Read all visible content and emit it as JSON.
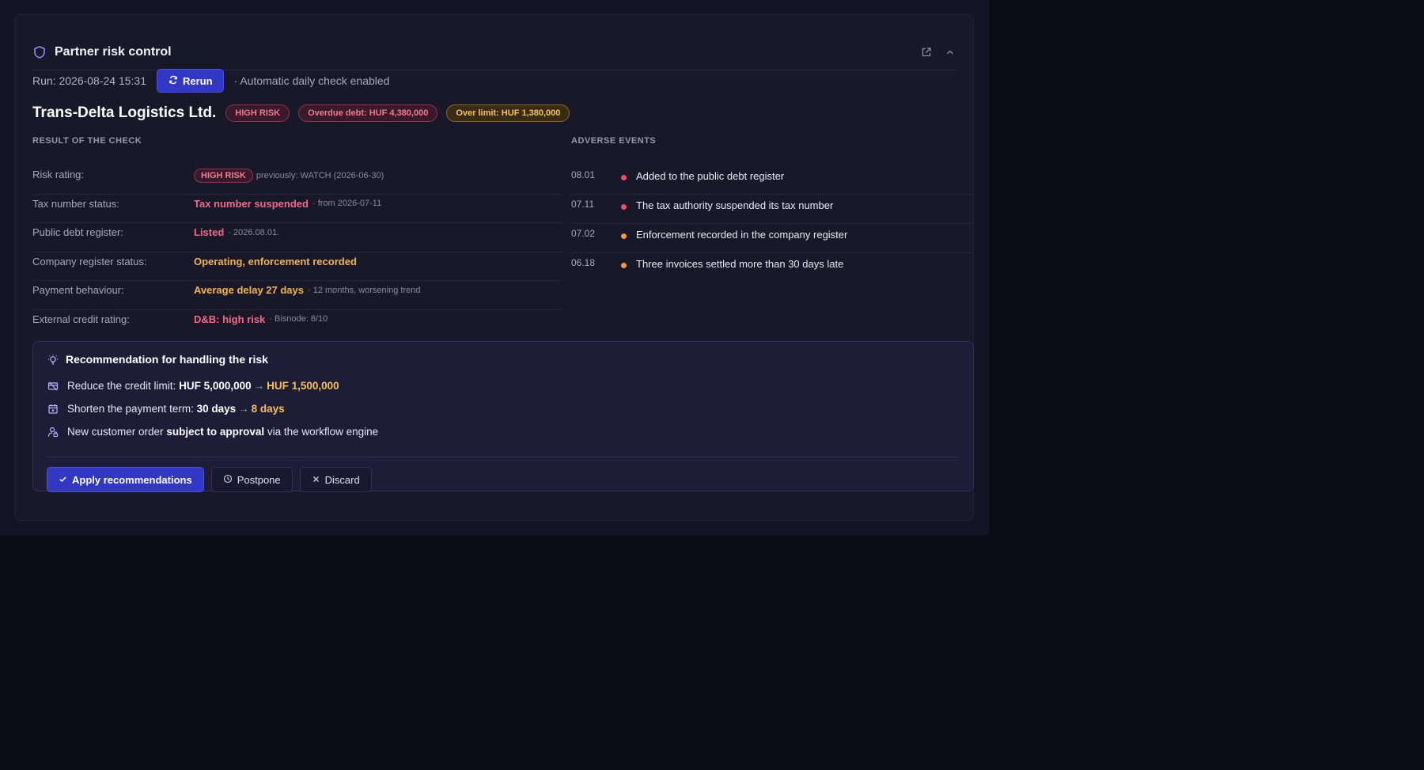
{
  "header": {
    "title": "Partner risk control",
    "icons": [
      "shield-icon",
      "external-link-icon",
      "chevron-up-icon"
    ]
  },
  "run": {
    "label": "Run: 2026-08-24 15:31",
    "rerun_label": "Rerun",
    "auto": "· Automatic daily check enabled"
  },
  "partner": {
    "name": "Trans-Delta Logistics Ltd.",
    "badges": {
      "risk": "HIGH RISK",
      "overdue": "Overdue debt: HUF 4,380,000",
      "overlimit": "Over limit: HUF 1,380,000"
    }
  },
  "checks": {
    "title": "RESULT OF THE CHECK",
    "rows": [
      {
        "label": "Risk rating:",
        "value": "HIGH RISK",
        "note": "previously: WATCH (2026-06-30)"
      },
      {
        "label": "Tax number status:",
        "value": "Tax number suspended",
        "note": "· from 2026-07-11"
      },
      {
        "label": "Public debt register:",
        "value": "Listed",
        "note": "· 2026.08.01."
      },
      {
        "label": "Company register status:",
        "value": "Operating, enforcement recorded",
        "note": ""
      },
      {
        "label": "Payment behaviour:",
        "value": "Average delay 27 days",
        "note": "· 12 months, worsening trend"
      },
      {
        "label": "External credit rating:",
        "value": "D&B: high risk",
        "note": "· Bisnode: 8/10"
      }
    ]
  },
  "events": {
    "title": "ADVERSE EVENTS",
    "items": [
      {
        "date": "08.01",
        "text": "Added to the public debt register",
        "severity_color": "#e84d6e"
      },
      {
        "date": "07.11",
        "text": "The tax authority suspended its tax number",
        "severity_color": "#e84d6e"
      },
      {
        "date": "07.02",
        "text": "Enforcement recorded in the company register",
        "severity_color": "#f39a3a"
      },
      {
        "date": "06.18",
        "text": "Three invoices settled more than 30 days late",
        "severity_color": "#f39a3a"
      }
    ]
  },
  "recommendation": {
    "title": "Recommendation for handling the risk",
    "limit": {
      "prefix": "Reduce the credit limit:",
      "from": "HUF 5,000,000",
      "arrow": "→",
      "to": "HUF 1,500,000"
    },
    "term": {
      "prefix": "Shorten the payment term:",
      "from": "30 days",
      "arrow": "→",
      "to": "8 days"
    },
    "order": {
      "prefix": "New customer order",
      "bold": "subject to approval",
      "suffix": "via the workflow engine"
    },
    "buttons": {
      "apply": "Apply recommendations",
      "postpone": "Postpone",
      "discard": "Discard"
    }
  },
  "colors": {
    "accent": "#3338c4",
    "danger": "#f06a88",
    "warning": "#f3b454",
    "background": "#0c0c16"
  }
}
